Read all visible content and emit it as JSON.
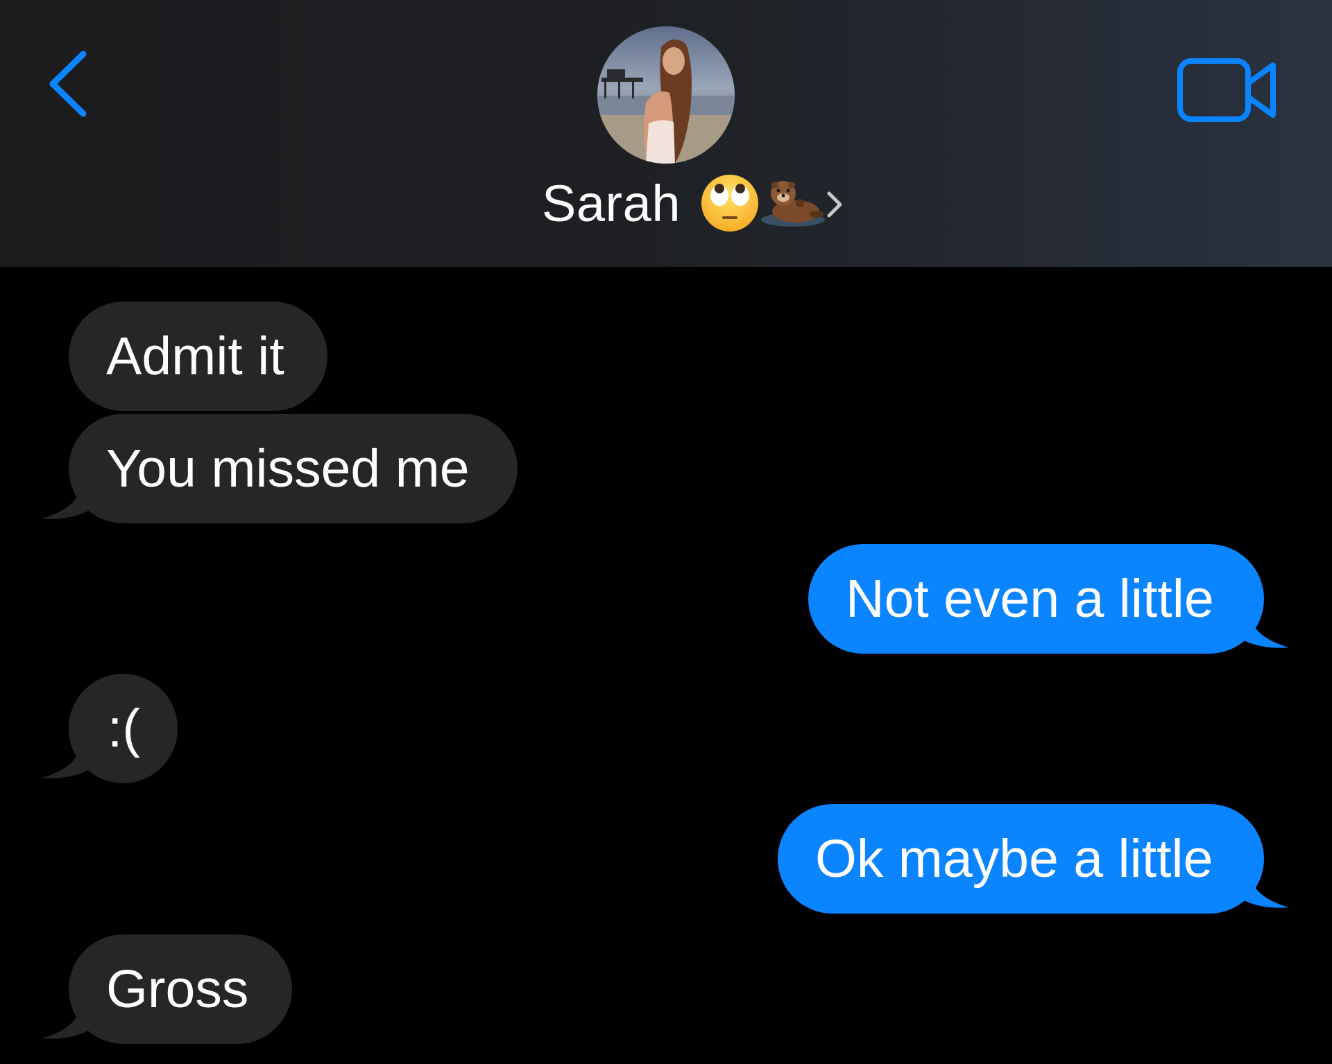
{
  "header": {
    "contact_name": "Sarah",
    "name_emojis": [
      "eye-roll-emoji",
      "otter-emoji"
    ]
  },
  "colors": {
    "accent": "#0a84ff",
    "incoming_bubble": "#262629",
    "outgoing_bubble": "#0a84ff",
    "background": "#000000",
    "text": "#ffffff"
  },
  "messages": [
    {
      "direction": "incoming",
      "text": "Admit it"
    },
    {
      "direction": "incoming",
      "text": "You missed me"
    },
    {
      "direction": "outgoing",
      "text": "Not even a little"
    },
    {
      "direction": "incoming",
      "text": ":("
    },
    {
      "direction": "outgoing",
      "text": "Ok maybe a little"
    },
    {
      "direction": "incoming",
      "text": "Gross"
    }
  ]
}
